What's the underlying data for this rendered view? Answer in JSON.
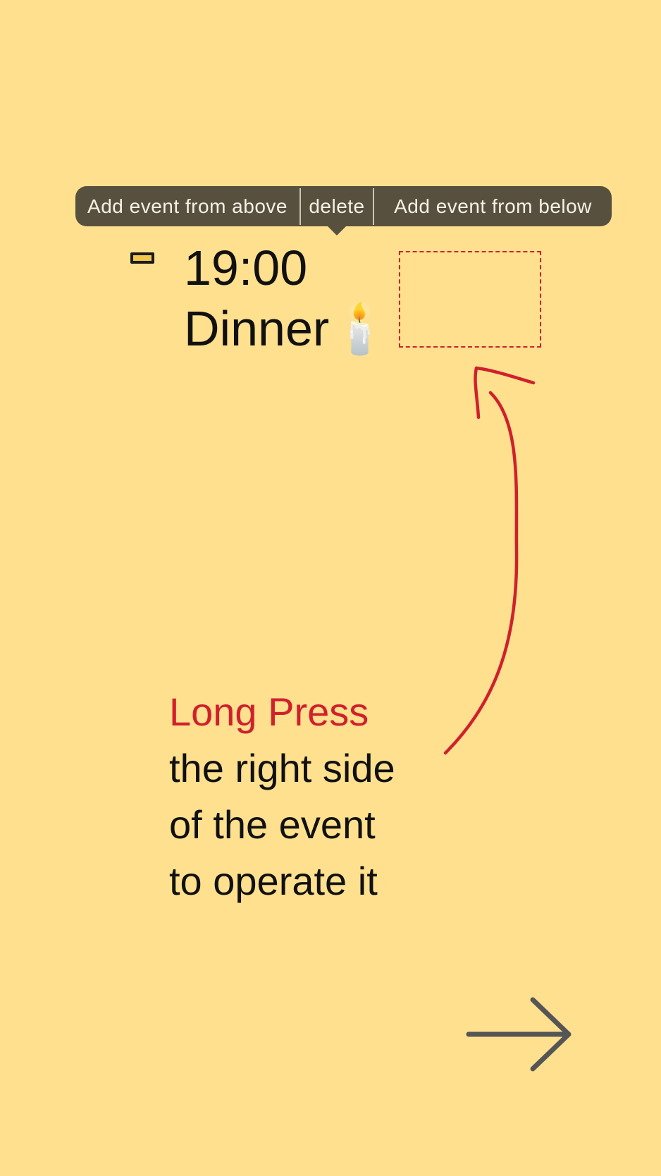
{
  "context_menu": {
    "items": [
      {
        "label": "Add event from above"
      },
      {
        "label": "delete"
      },
      {
        "label": "Add event from below"
      }
    ]
  },
  "event": {
    "time": "19:00",
    "title": "Dinner🕯️"
  },
  "hint": {
    "accent": "Long Press",
    "line2": "the right side",
    "line3": "of the event",
    "line4": "to operate it"
  },
  "colors": {
    "background": "#FFE08F",
    "menu_background": "#58503F",
    "accent": "#D0202C",
    "marker_fill": "#F2C54B",
    "next_arrow": "#555555"
  },
  "icons": {
    "next": "arrow-right-icon",
    "annotation": "curved-arrow-icon"
  }
}
